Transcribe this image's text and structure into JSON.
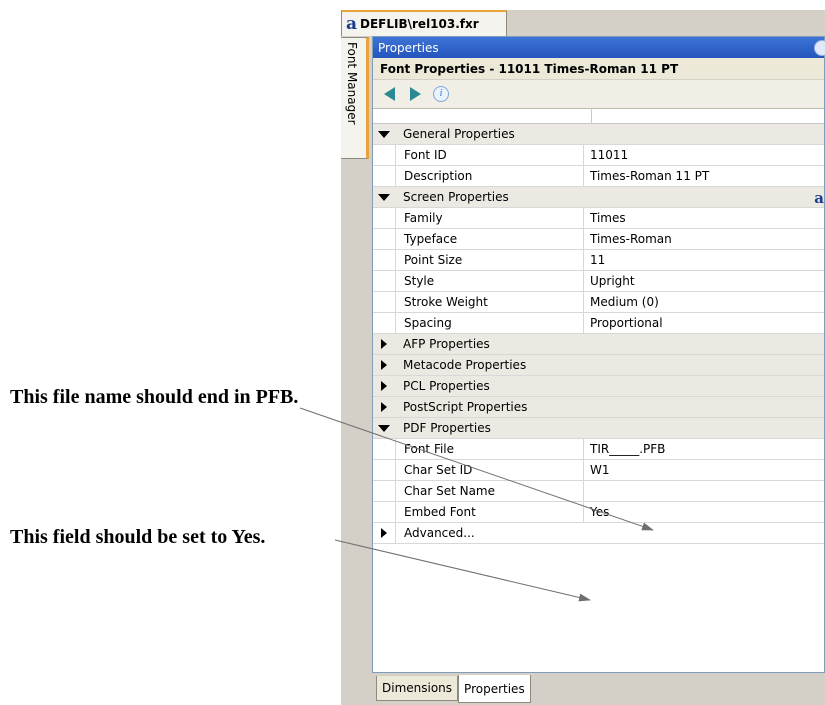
{
  "callouts": {
    "file_name": "This file name should end in PFB.",
    "embed": "This field should be set to Yes."
  },
  "window": {
    "doc_tab": "DEFLIB\\rel103.fxr",
    "side_tab": "Font Manager",
    "panel_title": "Properties",
    "font_title": "Font Properties - 11011  Times-Roman 11 PT"
  },
  "toolbar": {
    "back_icon": "back-arrow-icon",
    "forward_icon": "forward-arrow-icon",
    "info_icon": "info-icon"
  },
  "general": {
    "label": "General Properties",
    "rows": [
      {
        "name": "Font ID",
        "value": "11011"
      },
      {
        "name": "Description",
        "value": "Times-Roman 11 PT"
      }
    ]
  },
  "screen": {
    "label": "Screen Properties",
    "rows": [
      {
        "name": "Family",
        "value": "Times"
      },
      {
        "name": "Typeface",
        "value": "Times-Roman"
      },
      {
        "name": "Point Size",
        "value": "11"
      },
      {
        "name": "Style",
        "value": "Upright"
      },
      {
        "name": "Stroke Weight",
        "value": "Medium (0)"
      },
      {
        "name": "Spacing",
        "value": "Proportional"
      }
    ]
  },
  "collapsed": [
    "AFP Properties",
    "Metacode Properties",
    "PCL Properties",
    "PostScript Properties"
  ],
  "pdf": {
    "label": "PDF Properties",
    "rows": [
      {
        "name": "Font File",
        "value": "TIR_____.PFB"
      },
      {
        "name": "Char Set ID",
        "value": "W1"
      },
      {
        "name": "Char Set Name",
        "value": ""
      },
      {
        "name": "Embed Font",
        "value": "Yes"
      }
    ]
  },
  "advanced": "Advanced...",
  "bottom_tabs": [
    "Dimensions",
    "Properties"
  ]
}
